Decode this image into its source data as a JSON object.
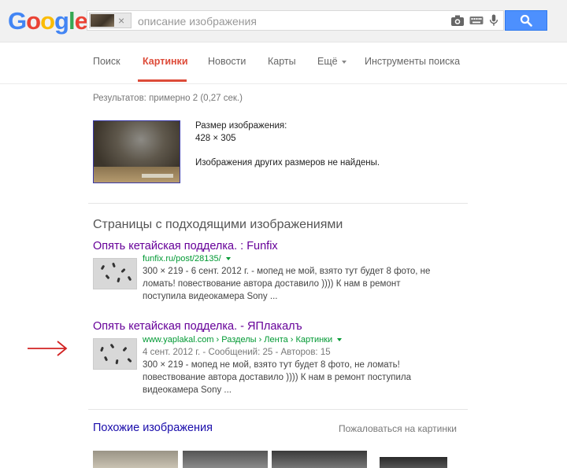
{
  "logo": {
    "letters": [
      "G",
      "o",
      "o",
      "g",
      "l",
      "e"
    ],
    "colors": [
      "#4285f4",
      "#ea4335",
      "#fbbc05",
      "#4285f4",
      "#34a853",
      "#ea4335"
    ]
  },
  "search": {
    "placeholder": "описание изображения",
    "chip_close": "×"
  },
  "icons": {
    "camera": "camera-icon",
    "keyboard": "keyboard-icon",
    "mic": "microphone-icon",
    "search": "search-icon"
  },
  "nav": {
    "items": [
      "Поиск",
      "Картинки",
      "Новости",
      "Карты",
      "Ещё",
      "Инструменты поиска"
    ],
    "active_index": 1
  },
  "stats": "Результатов: примерно 2 (0,27 сек.)",
  "image_info": {
    "size_label": "Размер изображения:",
    "size_value": "428 × 305",
    "no_other_sizes": "Изображения других размеров не найдены."
  },
  "pages_section_title": "Страницы с подходящими изображениями",
  "results": [
    {
      "title": "Опять кетайская подделка. : Funfix",
      "url": "funfix.ru/post/28135/",
      "snippet_lines": [
        "300 × 219 - 6 сент. 2012 г. - мопед не мой, взято тут будет 8 фото, не",
        "ломать! повествование автора доставило )))) К нам в ремонт",
        "поступила видеокамера Sony ..."
      ]
    },
    {
      "title": "Опять кетайская подделка. - ЯПлакалъ",
      "url": "www.yaplakal.com › Разделы › Лента › Картинки",
      "meta": "4 сент. 2012 г. - Сообщений: 25 - Авторов: 15",
      "snippet_lines": [
        "300 × 219 - мопед не мой, взято тут будет 8 фото, не ломать!",
        "повествование автора доставило )))) К нам в ремонт поступила",
        "видеокамера Sony ..."
      ]
    }
  ],
  "similar_title": "Похожие изображения",
  "report_link": "Пожаловаться на картинки",
  "colors": {
    "accent_red": "#dd4b39",
    "link_visited": "#660099",
    "url_green": "#009933",
    "button_blue": "#4d90fe",
    "arrow_red": "#d22222"
  }
}
